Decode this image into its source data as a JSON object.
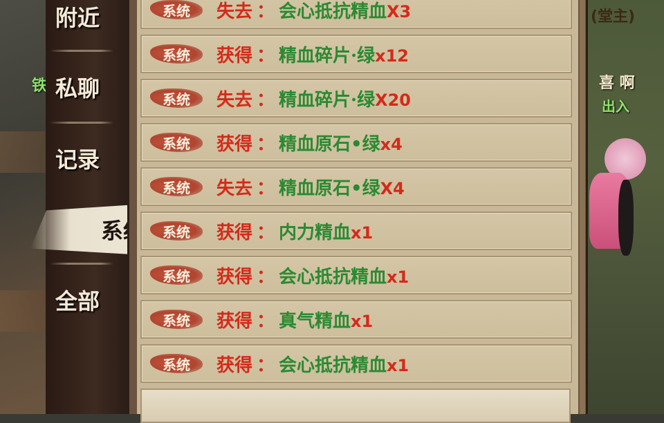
{
  "world": {
    "left_label": "铁",
    "right_title": "(堂主)",
    "right_name": "喜 啊",
    "right_sub": "出入"
  },
  "tabs": [
    {
      "label": "附近",
      "active": false
    },
    {
      "label": "私聊",
      "active": false
    },
    {
      "label": "记录",
      "active": false
    },
    {
      "label": "系统",
      "active": true
    },
    {
      "label": "全部",
      "active": false
    }
  ],
  "badge_label": "系统",
  "messages": [
    {
      "verb": "失去",
      "colon": "：",
      "item": "会心抵抗精血",
      "qty": "X3"
    },
    {
      "verb": "获得",
      "colon": "：",
      "item": "精血碎片·绿",
      "qty": "x12"
    },
    {
      "verb": "失去",
      "colon": "：",
      "item": "精血碎片·绿",
      "qty": "X20"
    },
    {
      "verb": "获得",
      "colon": "：",
      "item": "精血原石•绿",
      "qty": "x4"
    },
    {
      "verb": "失去",
      "colon": "：",
      "item": "精血原石•绿",
      "qty": "X4"
    },
    {
      "verb": "获得",
      "colon": "：",
      "item": "内力精血",
      "qty": "x1"
    },
    {
      "verb": "获得",
      "colon": "：",
      "item": "会心抵抗精血",
      "qty": "x1"
    },
    {
      "verb": "获得",
      "colon": "：",
      "item": "真气精血",
      "qty": "x1"
    },
    {
      "verb": "获得",
      "colon": "：",
      "item": "会心抵抗精血",
      "qty": "x1"
    }
  ],
  "colors": {
    "verb": "#d42a1a",
    "item": "#2a8a32",
    "badge": "#b04530",
    "row_bg": "#d4c6a6"
  }
}
